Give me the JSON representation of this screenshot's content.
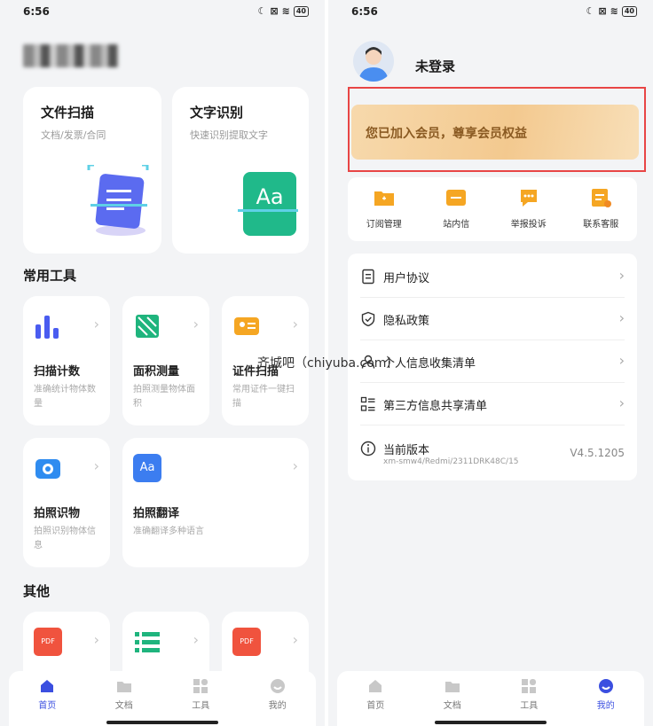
{
  "status_bar": {
    "time": "6:56",
    "battery": "40"
  },
  "home": {
    "feature_cards": [
      {
        "title": "文件扫描",
        "subtitle": "文档/发票/合同"
      },
      {
        "title": "文字识别",
        "subtitle": "快速识别提取文字",
        "icon_text": "Aa"
      }
    ],
    "section_common": "常用工具",
    "tools": [
      {
        "name": "扫描计数",
        "desc": "准确统计物体数量",
        "icon": "bar-chart-icon"
      },
      {
        "name": "面积测量",
        "desc": "拍照测量物体面积",
        "icon": "area-measure-icon"
      },
      {
        "name": "证件扫描",
        "desc": "常用证件一键扫描",
        "icon": "id-card-icon"
      },
      {
        "name": "拍照识物",
        "desc": "拍照识别物体信息",
        "icon": "camera-icon"
      },
      {
        "name": "拍照翻译",
        "desc": "准确翻译多种语言",
        "icon": "translate-icon",
        "icon_text": "Aa"
      }
    ],
    "section_other": "其他",
    "other_icons": [
      {
        "icon": "pdf-icon",
        "text": "PDF"
      },
      {
        "icon": "list-icon",
        "text": ""
      },
      {
        "icon": "pdf-convert-icon",
        "text": "PDF"
      }
    ]
  },
  "profile": {
    "username": "未登录",
    "vip_text": "您已加入会员，尊享会员权益",
    "quick_actions": [
      {
        "label": "订阅管理",
        "icon": "subscription-icon"
      },
      {
        "label": "站内信",
        "icon": "message-icon"
      },
      {
        "label": "举报投诉",
        "icon": "report-icon"
      },
      {
        "label": "联系客服",
        "icon": "service-icon"
      }
    ],
    "menu": [
      {
        "label": "用户协议",
        "icon": "document-icon"
      },
      {
        "label": "隐私政策",
        "icon": "shield-icon"
      },
      {
        "label": "个人信息收集清单",
        "icon": "person-icon"
      },
      {
        "label": "第三方信息共享清单",
        "icon": "grid-list-icon"
      }
    ],
    "version": {
      "label": "当前版本",
      "detail": "xm-smw4/Redmi/2311DRK48C/15",
      "number": "V4.5.1205"
    }
  },
  "tabs": [
    "首页",
    "文档",
    "工具",
    "我的"
  ],
  "watermark": "齐城吧（chiyuba.com）",
  "colors": {
    "accent": "#3b4fe0",
    "vip_text": "#8a5a22",
    "highlight": "#e84545"
  }
}
